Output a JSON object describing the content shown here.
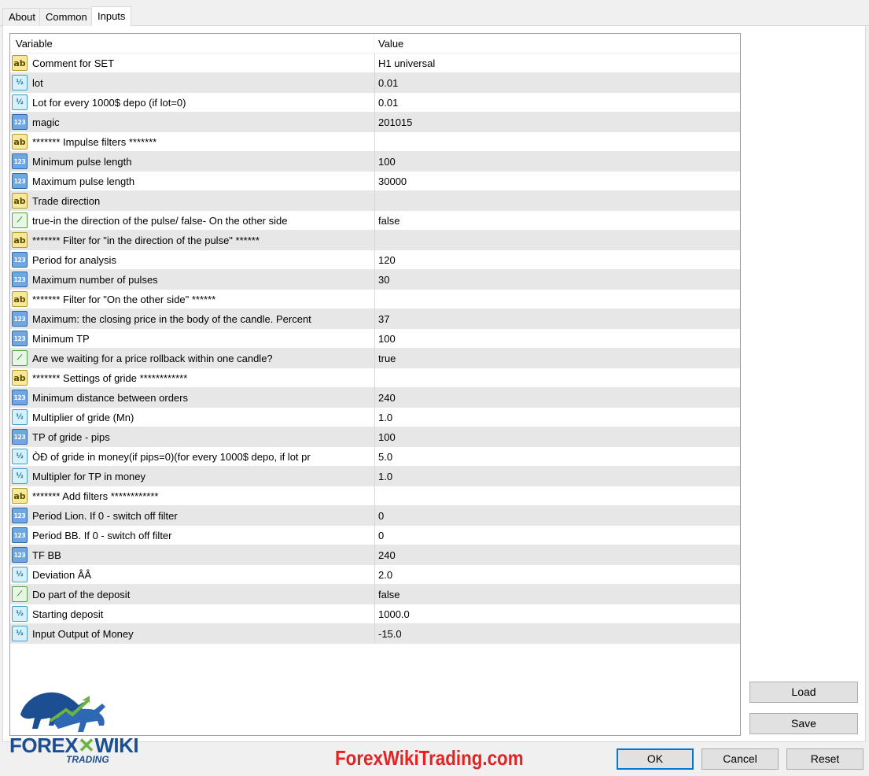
{
  "tabs": [
    {
      "label": "About"
    },
    {
      "label": "Common"
    },
    {
      "label": "Inputs"
    }
  ],
  "grid": {
    "headers": {
      "variable": "Variable",
      "value": "Value"
    },
    "rows": [
      {
        "type": "ab",
        "variable": "Comment for SET",
        "value": "H1 universal"
      },
      {
        "type": "half",
        "variable": "lot",
        "value": "0.01"
      },
      {
        "type": "half",
        "variable": "Lot for every 1000$ depo (if lot=0)",
        "value": "0.01"
      },
      {
        "type": "num",
        "variable": "magic",
        "value": "201015"
      },
      {
        "type": "ab",
        "variable": "******* Impulse filters *******",
        "value": ""
      },
      {
        "type": "num",
        "variable": "Minimum pulse length",
        "value": "100"
      },
      {
        "type": "num",
        "variable": "Maximum pulse length",
        "value": "30000"
      },
      {
        "type": "ab",
        "variable": "Trade direction",
        "value": ""
      },
      {
        "type": "bool",
        "variable": "true-in the direction of the pulse/ false- On the other side",
        "value": "false"
      },
      {
        "type": "ab",
        "variable": "******* Filter for \"in the direction of the pulse\" ******",
        "value": ""
      },
      {
        "type": "num",
        "variable": "Period for analysis",
        "value": "120"
      },
      {
        "type": "num",
        "variable": "Maximum number of pulses",
        "value": "30"
      },
      {
        "type": "ab",
        "variable": "******* Filter for \"On the other side\"  ******",
        "value": ""
      },
      {
        "type": "num",
        "variable": "Maximum: the closing price in the body of the candle. Percent",
        "value": "37"
      },
      {
        "type": "num",
        "variable": "Minimum TP",
        "value": "100"
      },
      {
        "type": "bool",
        "variable": "Are we waiting for a price rollback within one candle?",
        "value": "true"
      },
      {
        "type": "ab",
        "variable": "******* Settings of gride ************",
        "value": ""
      },
      {
        "type": "num",
        "variable": "Minimum distance between orders",
        "value": "240"
      },
      {
        "type": "half",
        "variable": "Multiplier of gride (Mn)",
        "value": "1.0"
      },
      {
        "type": "num",
        "variable": "TP of gride - pips",
        "value": "100"
      },
      {
        "type": "half",
        "variable": "ÒÐ of gride in money(if pips=0)(for every 1000$ depo, if lot pr",
        "value": "5.0"
      },
      {
        "type": "half",
        "variable": "Multipler for TP in money",
        "value": "1.0"
      },
      {
        "type": "ab",
        "variable": "******* Add filters       ************",
        "value": ""
      },
      {
        "type": "num",
        "variable": "Period Lion. If 0 - switch off filter",
        "value": "0"
      },
      {
        "type": "num",
        "variable": "Period BB.   If 0 - switch off filter",
        "value": "0"
      },
      {
        "type": "num",
        "variable": "TF BB",
        "value": "240"
      },
      {
        "type": "half",
        "variable": "Deviation ÂÂ",
        "value": "2.0"
      },
      {
        "type": "bool",
        "variable": "Do part of the deposit",
        "value": "false"
      },
      {
        "type": "half",
        "variable": "Starting deposit",
        "value": "1000.0"
      },
      {
        "type": "half",
        "variable": "Input Output of Money",
        "value": "-15.0"
      }
    ]
  },
  "icons": {
    "ab": {
      "name": "string-icon",
      "glyph": "ab"
    },
    "half": {
      "name": "double-icon",
      "glyph": "½"
    },
    "num": {
      "name": "integer-icon",
      "glyph": "123"
    },
    "bool": {
      "name": "bool-icon",
      "glyph": "⟋"
    }
  },
  "buttons": {
    "load": "Load",
    "save": "Save",
    "ok": "OK",
    "cancel": "Cancel",
    "reset": "Reset"
  },
  "brand": {
    "watermark": "ForexWikiTrading.com",
    "logo_forex": "FOREX",
    "logo_wiki": "WIKI",
    "logo_trading": "TRADING"
  },
  "colors": {
    "accent": "#0078d7",
    "watermark": "#e52222",
    "logo": "#1c4f91",
    "row_alt": "#e7e7e7"
  }
}
